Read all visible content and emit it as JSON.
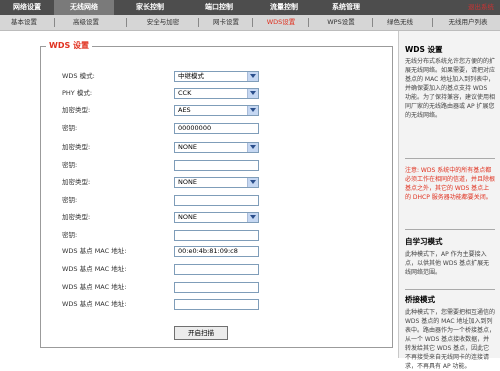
{
  "top_nav": {
    "items": [
      {
        "label": "网络设置"
      },
      {
        "label": "无线网络"
      },
      {
        "label": "家长控制"
      },
      {
        "label": "端口控制"
      },
      {
        "label": "流量控制"
      },
      {
        "label": "系统管理"
      }
    ],
    "logout": "退出系统"
  },
  "sub_nav": {
    "tabs": [
      {
        "label": "基本设置"
      },
      {
        "label": "高级设置"
      },
      {
        "label": "安全与加密"
      },
      {
        "label": "网卡设置"
      },
      {
        "label": "WDS设置"
      },
      {
        "label": "WPS设置"
      },
      {
        "label": "绿色无线"
      },
      {
        "label": "无线用户列表"
      }
    ]
  },
  "wds": {
    "title": "WDS 设置",
    "mode_label": "WDS 模式:",
    "mode_value": "中继模式",
    "phy_label": "PHY 模式:",
    "phy_value": "CCK",
    "enc1_label": "加密类型:",
    "enc1_value": "AES",
    "key1_label": "密钥:",
    "key1_value": "00000000",
    "enc2_label": "加密类型:",
    "enc2_value": "NONE",
    "key2_label": "密钥:",
    "key2_value": "",
    "enc3_label": "加密类型:",
    "enc3_value": "NONE",
    "key3_label": "密钥:",
    "key3_value": "",
    "enc4_label": "加密类型:",
    "enc4_value": "NONE",
    "key4_label": "密钥:",
    "key4_value": "",
    "mac1_label": "WDS 基点 MAC 地址:",
    "mac1_value": "00:e0:4b:81:09:c8",
    "mac2_label": "WDS 基点 MAC 地址:",
    "mac2_value": "",
    "mac3_label": "WDS 基点 MAC 地址:",
    "mac3_value": "",
    "mac4_label": "WDS 基点 MAC 地址:",
    "mac4_value": "",
    "scan_button": "开启扫描"
  },
  "help": {
    "title": "WDS 设置",
    "intro": "无线分布式系统允许您方便的的扩展无线网络。如果需要，请把对应基点的 MAC 地址加入到列表中，并确保要加入的基点支持 WDS 功能。为了保持兼容，建议使用相同厂家的无线路由器或 AP 扩展您的无线网络。",
    "warning": "注意: WDS 系统中的所有基点都必须工作在相同的信道，并且除根基点之外，其它的 WDS 基点上的 DHCP 服务器功能都要关闭。",
    "learn_title": "自学习模式",
    "learn_text": "此种模式下，AP 作为主要接入点，以供其他 WDS 基点扩展无线网络范围。",
    "bridge_title": "桥接模式",
    "bridge_text": "此种模式下，您需要把相互通信的 WDS 基点的 MAC 地址加入到列表中。路由器作为一个桥接基点，从一个 WDS 基点接收数据，并转发给其它 WDS 基点，因此它不再接受来自无线网卡的连接请求，不再具有 AP 功能。"
  },
  "colors": {
    "accent": "#e0301e",
    "top_nav_bg": "#4d4d4d",
    "sub_nav_bg": "#d6d6d6"
  }
}
